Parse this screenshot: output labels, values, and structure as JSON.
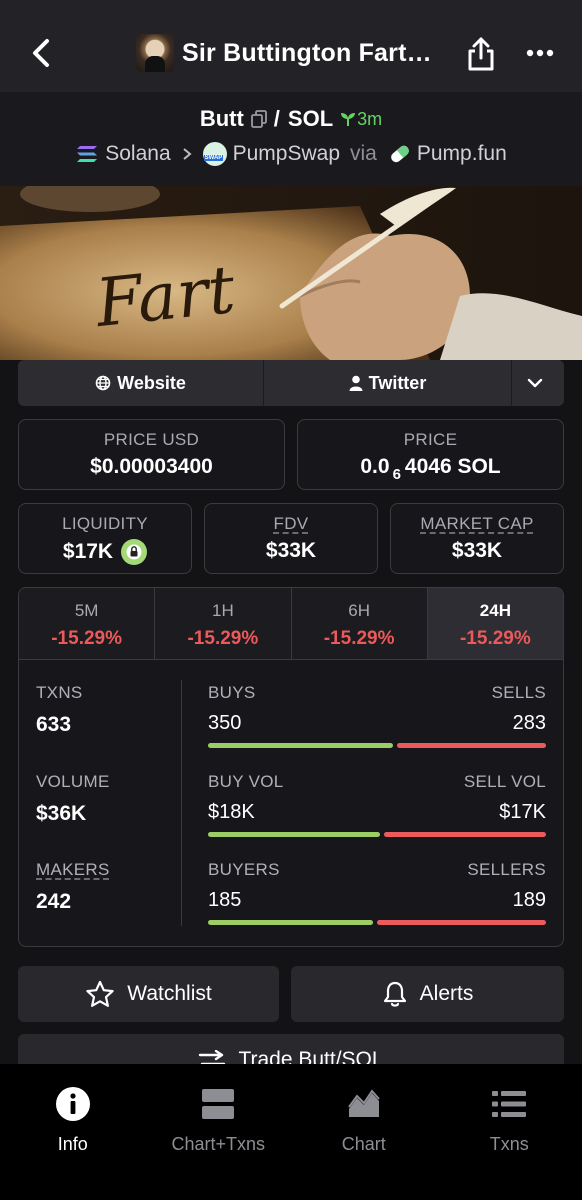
{
  "header": {
    "title": "Sir Buttington Fart…",
    "back_icon": "chevron-left-icon",
    "share_icon": "share-icon",
    "more_icon": "more-dots-icon"
  },
  "pair": {
    "base": "Butt",
    "separator": "/",
    "quote": "SOL",
    "age": "3m",
    "chain": "Solana",
    "dex": "PumpSwap",
    "via": "via",
    "launchpad": "Pump.fun"
  },
  "banner": {
    "title": "Fart"
  },
  "links": {
    "website": "Website",
    "twitter": "Twitter"
  },
  "stats": {
    "price_usd_label": "PRICE USD",
    "price_usd": "$0.00003400",
    "price_label": "PRICE",
    "price_prefix": "0.0",
    "price_zeros": "6",
    "price_rest": "4046 SOL",
    "liquidity_label": "LIQUIDITY",
    "liquidity": "$17K",
    "fdv_label": "FDV",
    "fdv": "$33K",
    "mcap_label": "MARKET CAP",
    "mcap": "$33K"
  },
  "timeframes": [
    {
      "label": "5M",
      "change": "-15.29%"
    },
    {
      "label": "1H",
      "change": "-15.29%"
    },
    {
      "label": "6H",
      "change": "-15.29%"
    },
    {
      "label": "24H",
      "change": "-15.29%"
    }
  ],
  "metrics": {
    "txns_label": "TXNS",
    "txns": "633",
    "volume_label": "VOLUME",
    "volume": "$36K",
    "makers_label": "MAKERS",
    "makers": "242",
    "buys_label": "BUYS",
    "buys": "350",
    "sells_label": "SELLS",
    "sells": "283",
    "buy_vol_label": "BUY VOL",
    "buy_vol": "$18K",
    "sell_vol_label": "SELL VOL",
    "sell_vol": "$17K",
    "buyers_label": "BUYERS",
    "buyers": "185",
    "sellers_label": "SELLERS",
    "sellers": "189"
  },
  "ratios": {
    "buys_fraction": 0.553,
    "buy_vol_fraction": 0.514,
    "buyers_fraction": 0.495
  },
  "actions": {
    "watchlist": "Watchlist",
    "alerts": "Alerts",
    "trade": "Trade Butt/SOL"
  },
  "nav": [
    {
      "label": "Info",
      "icon": "info-icon"
    },
    {
      "label": "Chart+Txns",
      "icon": "split-view-icon"
    },
    {
      "label": "Chart",
      "icon": "area-chart-icon"
    },
    {
      "label": "Txns",
      "icon": "list-icon"
    }
  ],
  "colors": {
    "positive": "#9ccc65",
    "negative": "#ec5b5b",
    "accent_green": "#66d266"
  }
}
